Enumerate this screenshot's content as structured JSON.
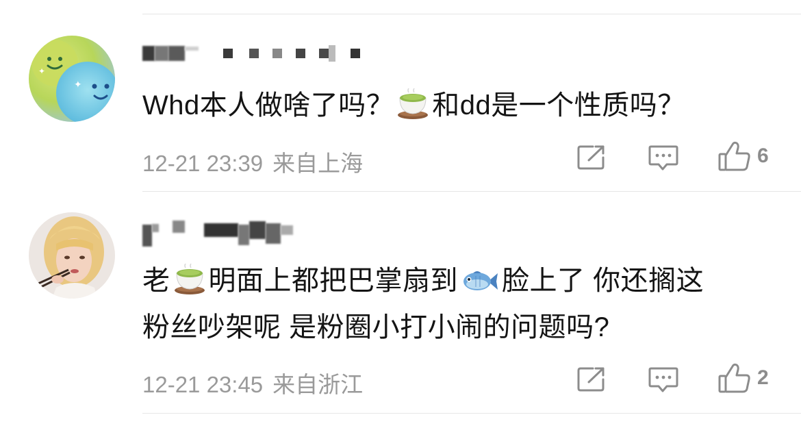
{
  "comments": [
    {
      "username": "",
      "text_parts": [
        "Whd本人做啥了吗？",
        "和dd是一个性质吗？"
      ],
      "emoji_1": "tea-cup",
      "line2": "",
      "time": "12-21 23:39",
      "location": "来自上海",
      "likes": "6"
    },
    {
      "username": "",
      "text_parts": [
        "老",
        "明面上都把巴掌扇到",
        "脸上了 你还搁这"
      ],
      "emoji_1": "tea-cup",
      "emoji_2": "fish",
      "line2": "粉丝吵架呢 是粉圈小打小闹的问题吗?",
      "time": "12-21 23:45",
      "location": "来自浙江",
      "likes": "2"
    }
  ],
  "icons": {
    "share": "share-icon",
    "comment": "comment-icon",
    "like": "thumbs-up-icon"
  },
  "colors": {
    "text": "#141414",
    "meta": "#9a9a9a",
    "icon": "#8c8c8c",
    "divider": "#e6e6e6"
  }
}
